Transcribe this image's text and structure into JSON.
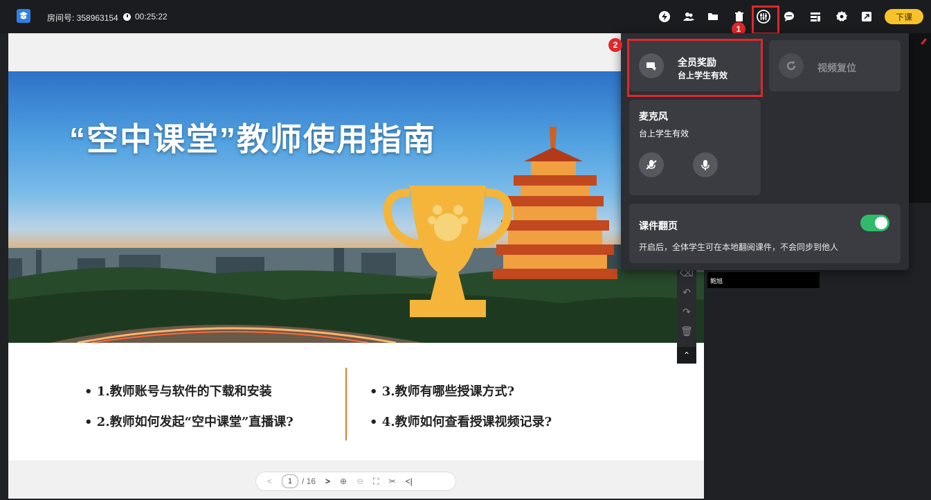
{
  "header": {
    "room_label": "房间号: 358963154",
    "timer": "00:25:22",
    "end_class_label": "下课",
    "icons": [
      "lightning-icon",
      "users-icon",
      "folder-icon",
      "trash-icon",
      "mixer-icon",
      "chat-icon",
      "layout-icon",
      "settings-icon",
      "window-icon"
    ]
  },
  "slide": {
    "title": "“空中课堂”教师使用指南",
    "bullets_left": [
      "1.教师账号与软件的下载和安装",
      "2.教师如何发起“空中课堂”直播课?"
    ],
    "bullets_right": [
      "3.教师有哪些授课方式?",
      "4.教师如何查看授课视频记录?"
    ],
    "bullet_char": "•"
  },
  "pager": {
    "current": "1",
    "total": "/ 16"
  },
  "mini_video": {
    "name": "鲍旭"
  },
  "panel": {
    "reward": {
      "title": "全员奖励",
      "subtitle": "台上学生有效"
    },
    "video_reset": {
      "title": "视频复位"
    },
    "mic": {
      "title": "麦克风",
      "subtitle": "台上学生有效"
    },
    "page_turn": {
      "title": "课件翻页",
      "desc": "开启后，全体学生可在本地翻阅课件，不会同步到他人",
      "enabled": true
    }
  },
  "annotations": {
    "badge1": "1",
    "badge2": "2",
    "highlight_color": "#e0282b"
  },
  "colors": {
    "accent_yellow": "#f8c32a",
    "toggle_green": "#2fbb6a",
    "trophy_gold": "#f4b53a"
  }
}
